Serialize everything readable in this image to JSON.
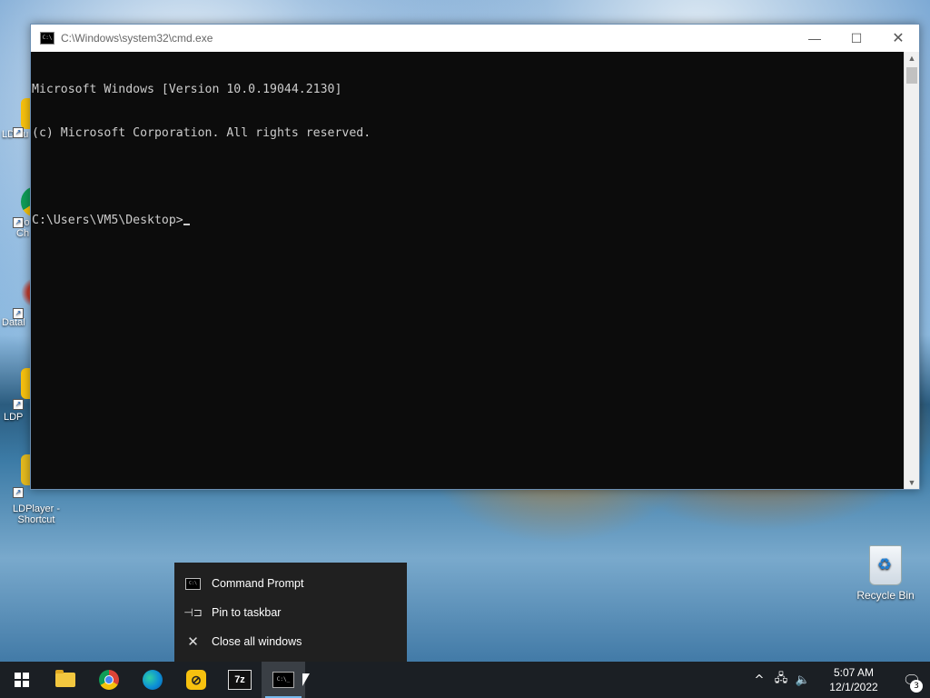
{
  "desktop": {
    "icons": [
      {
        "label": "LDMu",
        "icon": "ldmultiplayer-icon",
        "color": "#f7c10f"
      },
      {
        "label": "Go\nCh",
        "icon": "chrome-icon",
        "color": "#db4437"
      },
      {
        "label": "Datal",
        "icon": "datalore-icon",
        "color": "#c0392b"
      },
      {
        "label": "LDP",
        "icon": "ldplayer-icon",
        "color": "#f7c10f"
      },
      {
        "label": "LDPlayer -\nShortcut",
        "icon": "ldplayer-shortcut-icon",
        "color": "#f7c10f"
      }
    ],
    "recycle_bin": {
      "label": "Recycle Bin"
    }
  },
  "cmd_window": {
    "title": "C:\\Windows\\system32\\cmd.exe",
    "lines": [
      "Microsoft Windows [Version 10.0.19044.2130]",
      "(c) Microsoft Corporation. All rights reserved.",
      "",
      "C:\\Users\\VM5\\Desktop>"
    ],
    "controls": {
      "minimize": "—",
      "maximize": "☐",
      "close": "✕"
    }
  },
  "jumplist": {
    "items": [
      {
        "label": "Command Prompt",
        "icon": "command-prompt-icon"
      },
      {
        "label": "Pin to taskbar",
        "icon": "pin-icon"
      },
      {
        "label": "Close all windows",
        "icon": "close-icon"
      }
    ]
  },
  "taskbar": {
    "apps": [
      "start",
      "file-explorer",
      "chrome",
      "edge",
      "ldplayer",
      "7-zip",
      "command-prompt"
    ],
    "sevenzip_label": "7z",
    "cmd_label": "C:\\_",
    "clock": {
      "time": "5:07 AM",
      "date": "12/1/2022"
    },
    "notification_count": "3",
    "active_color": "#76b9ed"
  }
}
